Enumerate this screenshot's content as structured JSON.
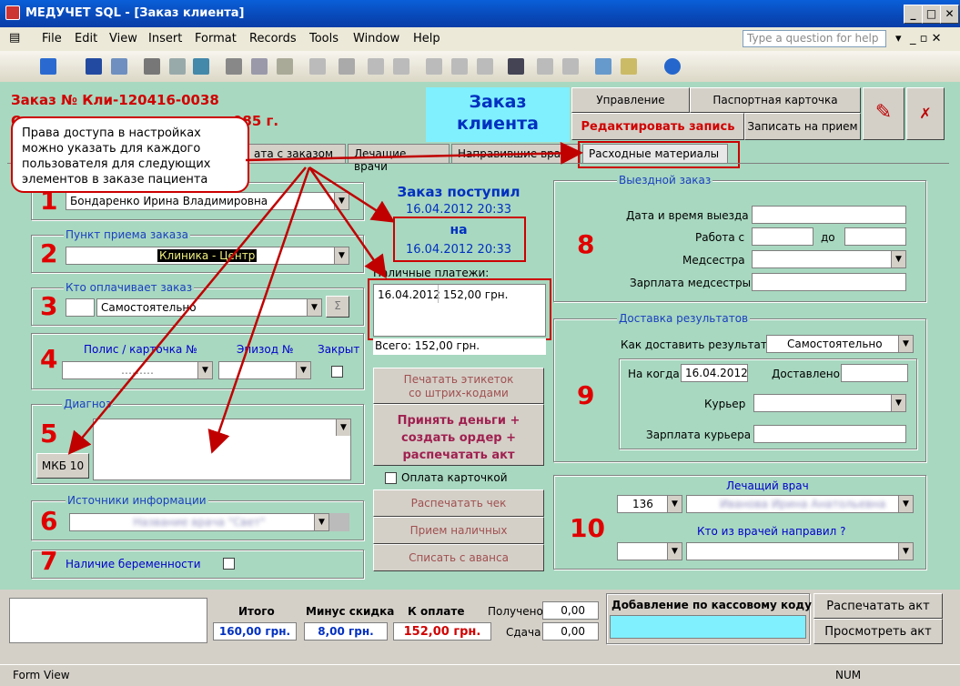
{
  "window": {
    "title": "МЕДУЧЕТ SQL - [Заказ клиента]"
  },
  "menu": [
    "File",
    "Edit",
    "View",
    "Insert",
    "Format",
    "Records",
    "Tools",
    "Window",
    "Help"
  ],
  "question_placeholder": "Type a question for help",
  "header": {
    "order_line": "Заказ №  Кли-120416-0038",
    "order_line2": "О",
    "year_text": "985 г.r",
    "title_line1": "Заказ",
    "title_line2": "клиента"
  },
  "top_buttons": {
    "management": "Управление",
    "passport": "Паспортная карточка",
    "edit": "Редактировать запись",
    "appointment": "Записать на прием"
  },
  "callout": "Права доступа в настройках можно указать для каждого пользователя для следующих элементов в заказе пациента",
  "tabs": [
    "ата с заказом",
    "Лечащие врачи",
    "Направившие врач",
    "Расходные материалы"
  ],
  "sections": {
    "doctor_value": "Бондаренко Ирина Владимировна",
    "reception_label": "Пункт приема заказа",
    "reception_value": "Клиника - Центр",
    "payer_label": "Кто оплачивает заказ",
    "payer_value": "Самостоятельно",
    "sigma": "Σ",
    "policy_label": "Полис / карточка №",
    "episode_label": "Эпизод №",
    "closed_label": "Закрыт",
    "policy_value": "………",
    "diagnosis_label": "Диагноз",
    "mkb_button": "МКБ 10",
    "sources_label": "Источники информации",
    "sources_value": "Название врача \"Свет\"",
    "pregnancy_label": "Наличие беременности",
    "numbers": [
      "1",
      "2",
      "3",
      "4",
      "5",
      "6",
      "7",
      "8",
      "9",
      "10"
    ]
  },
  "order_received": {
    "label": "Заказ поступил",
    "date": "16.04.2012 20:33",
    "on": "на",
    "date2": "16.04.2012 20:33"
  },
  "cash": {
    "label": "Наличные платежи:",
    "row_date": "16.04.2012",
    "row_amount": "152,00 грн.",
    "total": "Всего: 152,00 грн."
  },
  "middle_buttons": {
    "print_labels": "Печатать этикеток\nсо штрих-кодами",
    "accept_money": "Принять деньги +\nсоздать ордер +\nраспечатать акт",
    "card_payment": "Оплата карточкой",
    "print_check": "Распечатать чек",
    "cash_receipt": "Прием наличных",
    "advance": "Списать с аванса"
  },
  "visit": {
    "label": "Выездной заказ",
    "datetime": "Дата и время выезда",
    "work_from": "Работа с",
    "to": "до",
    "nurse": "Медсестра",
    "nurse_salary": "Зарплата медсестры"
  },
  "delivery": {
    "label": "Доставка результатов",
    "how": "Как доставить результат?",
    "how_value": "Самостоятельно",
    "by_when": "На когда",
    "by_when_value": "16.04.2012",
    "delivered": "Доставлено",
    "courier": "Курьер",
    "courier_salary": "Зарплата курьера"
  },
  "doctors": {
    "attending": "Лечащий врач",
    "attending_code": "136",
    "attending_name": "Иванова Ирина Анатольевна",
    "referred": "Кто из врачей направил ?"
  },
  "totals": {
    "total_label": "Итого",
    "total": "160,00 грн.",
    "discount_label": "Минус скидка",
    "discount": "8,00 грн.",
    "to_pay_label": "К оплате",
    "to_pay": "152,00 грн.",
    "received_label": "Получено",
    "received": "0,00",
    "change_label": "Сдача",
    "change": "0,00",
    "cash_code_label": "Добавление по кассовому коду",
    "print_act": "Распечатать акт",
    "view_act": "Просмотреть акт"
  },
  "status": {
    "left": "Form View",
    "right": "NUM"
  }
}
